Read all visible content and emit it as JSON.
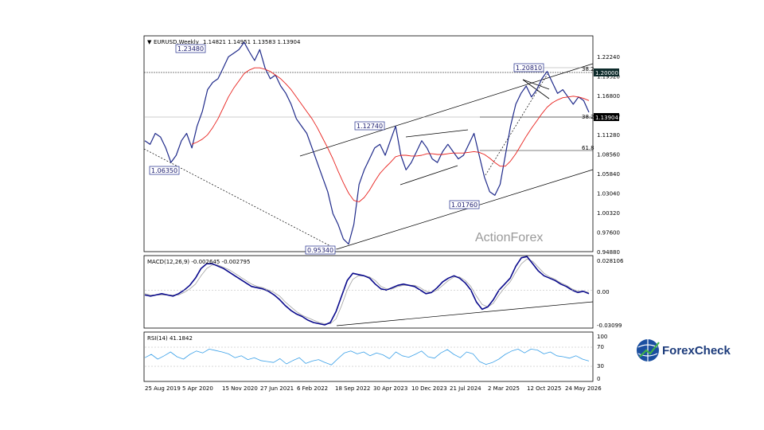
{
  "header": {
    "symbol": "EURUSD,Weekly",
    "ohlc": "1.14821 1.14951 1.13583 1.13904"
  },
  "watermark": "ActionForex",
  "brand": "ForexCheck",
  "colors": {
    "price": "#1f2a8a",
    "ma": "#e8201c",
    "macd": "#0a0a8c",
    "macd_signal": "#a0a0a0",
    "rsi": "#3aa0e8",
    "label_border": "#1f2a8a"
  },
  "chart_data": [
    {
      "type": "line",
      "panel": "price",
      "title": "EURUSD,Weekly",
      "ylim": [
        0.9488,
        1.2428
      ],
      "y_ticks": [
        "1.22240",
        "1.19520",
        "1.16800",
        "1.14080",
        "1.11280",
        "1.08560",
        "1.05840",
        "1.03040",
        "1.00320",
        "0.97600",
        "0.94880"
      ],
      "x_ticks": [
        "25 Aug 2019",
        "5 Apr 2020",
        "15 Nov 2020",
        "27 Jun 2021",
        "6 Feb 2022",
        "18 Sep 2022",
        "30 Apr 2023",
        "10 Dec 2023",
        "21 Jul 2024",
        "2 Mar 2025",
        "12 Oct 2025",
        "24 May 2026"
      ],
      "series": [
        {
          "values": [
            1.1,
            1.095,
            1.11,
            1.105,
            1.09,
            1.07,
            1.08,
            1.1,
            1.11,
            1.09,
            1.12,
            1.14,
            1.17,
            1.18,
            1.185,
            1.2,
            1.215,
            1.22,
            1.225,
            1.235,
            1.222,
            1.21,
            1.225,
            1.2,
            1.185,
            1.19,
            1.175,
            1.165,
            1.15,
            1.13,
            1.12,
            1.11,
            1.09,
            1.07,
            1.05,
            1.03,
            1.0,
            0.985,
            0.965,
            0.958,
            0.985,
            1.04,
            1.06,
            1.075,
            1.09,
            1.095,
            1.08,
            1.1,
            1.12,
            1.08,
            1.06,
            1.07,
            1.085,
            1.1,
            1.09,
            1.075,
            1.07,
            1.085,
            1.095,
            1.085,
            1.075,
            1.08,
            1.095,
            1.11,
            1.08,
            1.05,
            1.03,
            1.025,
            1.04,
            1.08,
            1.12,
            1.15,
            1.165,
            1.175,
            1.16,
            1.17,
            1.185,
            1.195,
            1.18,
            1.165,
            1.17,
            1.16,
            1.15,
            1.16,
            1.155,
            1.139
          ]
        },
        {
          "values": [
            null,
            null,
            null,
            null,
            null,
            null,
            null,
            null,
            null,
            1.095,
            1.098,
            1.102,
            1.108,
            1.118,
            1.13,
            1.145,
            1.16,
            1.172,
            1.182,
            1.192,
            1.197,
            1.2,
            1.2,
            1.198,
            1.195,
            1.19,
            1.185,
            1.178,
            1.17,
            1.16,
            1.15,
            1.14,
            1.13,
            1.118,
            1.104,
            1.09,
            1.075,
            1.058,
            1.042,
            1.028,
            1.018,
            1.016,
            1.022,
            1.032,
            1.044,
            1.055,
            1.063,
            1.07,
            1.078,
            1.08,
            1.08,
            1.079,
            1.079,
            1.08,
            1.082,
            1.082,
            1.081,
            1.081,
            1.082,
            1.083,
            1.083,
            1.083,
            1.084,
            1.085,
            1.084,
            1.081,
            1.076,
            1.07,
            1.065,
            1.065,
            1.072,
            1.082,
            1.094,
            1.106,
            1.117,
            1.127,
            1.137,
            1.146,
            1.152,
            1.156,
            1.159,
            1.16,
            1.161,
            1.16,
            1.158,
            1.155
          ]
        }
      ],
      "reference_lines": [
        {
          "label": "1.20000",
          "value": 1.2
        },
        {
          "label": "1.13904",
          "value": 1.13904
        },
        {
          "label": "38.2",
          "value": 1.1415
        },
        {
          "label": "61.8",
          "value": 1.0935
        },
        {
          "label": "38.2",
          "value": 1.2085
        }
      ],
      "annotations": [
        "1.23480",
        "1.06350",
        "1.12740",
        "0.95340",
        "1.01760",
        "1.20810"
      ]
    },
    {
      "type": "line",
      "panel": "macd",
      "title": "MACD(12,26,9) -0.002645 -0.002795",
      "ylim": [
        -0.03099,
        0.028106
      ],
      "y_ticks": [
        "0.028106",
        "0.00",
        "-0.03099"
      ],
      "series": [
        {
          "values": [
            -0.004,
            -0.005,
            -0.004,
            -0.003,
            -0.004,
            -0.005,
            -0.003,
            0.0,
            0.004,
            0.01,
            0.018,
            0.022,
            0.022,
            0.02,
            0.018,
            0.015,
            0.012,
            0.009,
            0.006,
            0.003,
            0.002,
            0.001,
            -0.001,
            -0.004,
            -0.008,
            -0.013,
            -0.017,
            -0.02,
            -0.022,
            -0.025,
            -0.027,
            -0.028,
            -0.029,
            -0.027,
            -0.018,
            -0.005,
            0.008,
            0.014,
            0.013,
            0.012,
            0.01,
            0.005,
            0.001,
            0.0,
            0.002,
            0.004,
            0.005,
            0.004,
            0.003,
            0.0,
            -0.003,
            -0.002,
            0.002,
            0.007,
            0.01,
            0.012,
            0.01,
            0.006,
            0.0,
            -0.01,
            -0.016,
            -0.014,
            -0.008,
            0.0,
            0.005,
            0.01,
            0.02,
            0.027,
            0.028,
            0.022,
            0.016,
            0.012,
            0.01,
            0.008,
            0.005,
            0.003,
            0.0,
            -0.002,
            -0.001,
            -0.003
          ]
        },
        {
          "values": [
            -0.003,
            -0.004,
            -0.004,
            -0.004,
            -0.004,
            -0.004,
            -0.004,
            -0.002,
            0.001,
            0.005,
            0.012,
            0.018,
            0.021,
            0.021,
            0.019,
            0.017,
            0.014,
            0.011,
            0.008,
            0.005,
            0.003,
            0.002,
            0.0,
            -0.002,
            -0.005,
            -0.01,
            -0.014,
            -0.018,
            -0.021,
            -0.023,
            -0.025,
            -0.027,
            -0.028,
            -0.028,
            -0.024,
            -0.013,
            0.0,
            0.009,
            0.012,
            0.012,
            0.011,
            0.008,
            0.003,
            0.001,
            0.001,
            0.003,
            0.004,
            0.004,
            0.004,
            0.002,
            -0.001,
            -0.002,
            0.0,
            0.004,
            0.008,
            0.011,
            0.011,
            0.008,
            0.003,
            -0.005,
            -0.012,
            -0.014,
            -0.011,
            -0.004,
            0.002,
            0.007,
            0.015,
            0.022,
            0.026,
            0.024,
            0.019,
            0.014,
            0.011,
            0.009,
            0.006,
            0.004,
            0.001,
            -0.001,
            -0.001,
            -0.002
          ]
        }
      ]
    },
    {
      "type": "line",
      "panel": "rsi",
      "title": "RSI(14) 41.1842",
      "ylim": [
        0,
        100
      ],
      "y_ticks": [
        "100",
        "70",
        "30",
        "0"
      ],
      "series": [
        {
          "values": [
            48,
            55,
            45,
            52,
            60,
            50,
            45,
            55,
            62,
            58,
            66,
            63,
            60,
            56,
            48,
            52,
            44,
            48,
            42,
            40,
            38,
            46,
            35,
            42,
            48,
            36,
            41,
            44,
            38,
            33,
            46,
            58,
            62,
            56,
            60,
            52,
            58,
            54,
            46,
            60,
            52,
            49,
            55,
            62,
            50,
            47,
            58,
            65,
            55,
            48,
            60,
            56,
            40,
            34,
            38,
            45,
            55,
            62,
            66,
            58,
            66,
            64,
            56,
            60,
            52,
            50,
            47,
            52,
            45,
            41
          ]
        }
      ]
    }
  ]
}
